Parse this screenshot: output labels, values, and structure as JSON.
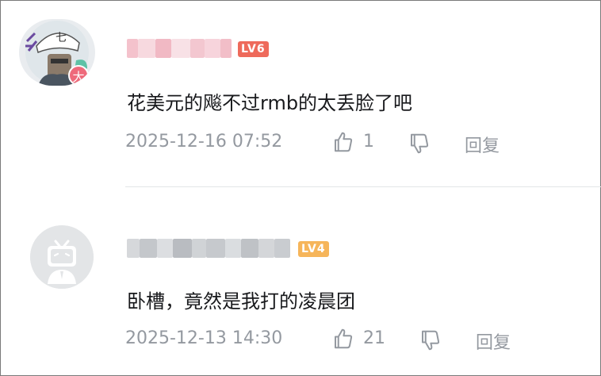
{
  "comments": [
    {
      "level_badge": "LV6",
      "text": "花美元的飚不过rmb的太丢脸了吧",
      "date": "2025-12-16 07:52",
      "likes": "1",
      "reply_label": "回复",
      "avatar_badge": "大",
      "avatar_mark": "七"
    },
    {
      "level_badge": "LV4",
      "text": "卧槽，竟然是我打的凌晨团",
      "date": "2025-12-13 14:30",
      "likes": "21",
      "reply_label": "回复"
    }
  ],
  "colors": {
    "text_primary": "#18191c",
    "text_secondary": "#9499a0",
    "level6": "#ee6a5b",
    "level4": "#f6b55a",
    "divider": "#e3e5e7"
  }
}
